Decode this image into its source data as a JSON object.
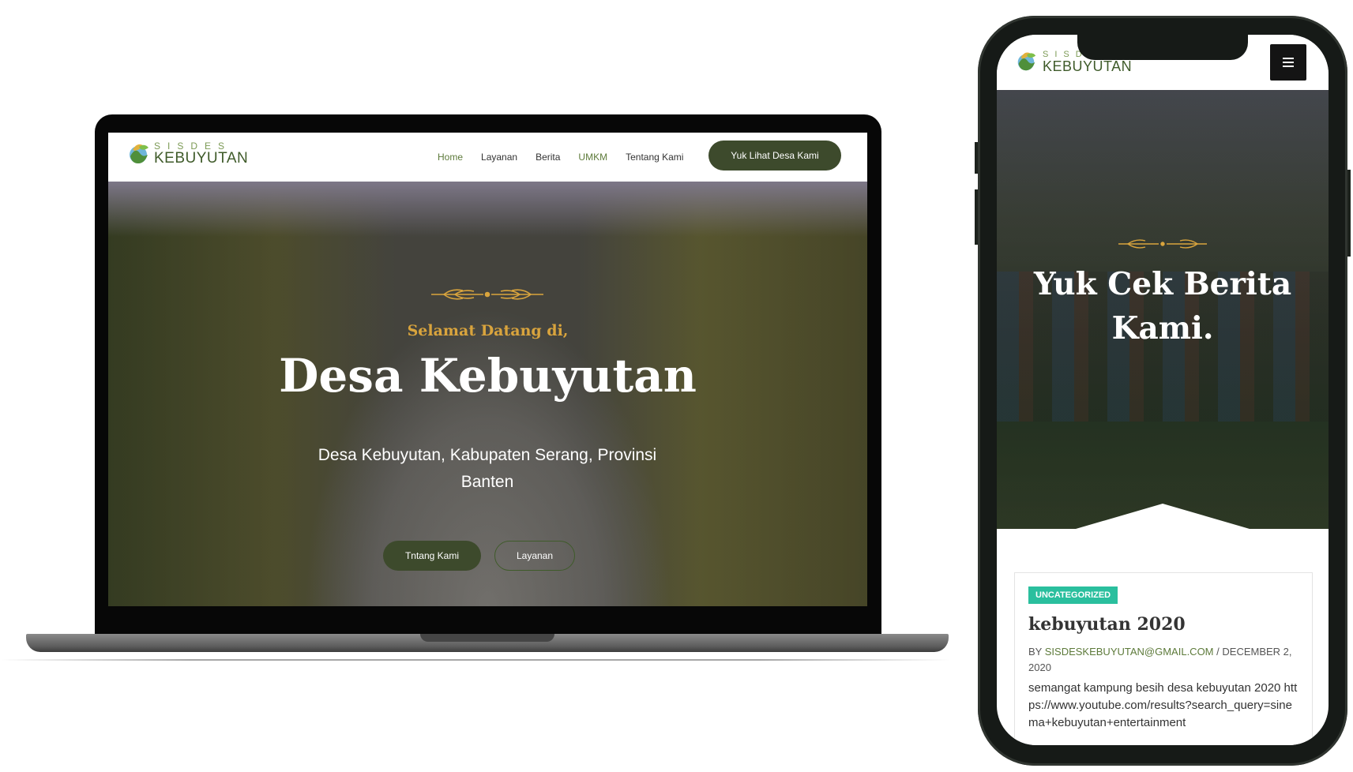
{
  "brand": {
    "logo_top": "SISDES",
    "logo_bottom": "KEBUYUTAN"
  },
  "laptop": {
    "nav": {
      "items": [
        {
          "label": "Home",
          "state": "active"
        },
        {
          "label": "Layanan",
          "state": ""
        },
        {
          "label": "Berita",
          "state": ""
        },
        {
          "label": "UMKM",
          "state": "highlight"
        },
        {
          "label": "Tentang Kami",
          "state": ""
        }
      ],
      "cta_label": "Yuk Lihat Desa Kami"
    },
    "hero": {
      "welcome": "Selamat Datang di,",
      "title": "Desa Kebuyutan",
      "subtitle": "Desa Kebuyutan, Kabupaten Serang, Provinsi Banten",
      "primary_button": "Tntang Kami",
      "secondary_button": "Layanan"
    }
  },
  "phone": {
    "hero_title": "Yuk Cek Berita Kami.",
    "post": {
      "category": "UNCATEGORIZED",
      "title": "kebuyutan 2020",
      "by_label": "BY",
      "author": "SISDESKEBUYUTAN@GMAIL.COM",
      "separator": "/",
      "date": "DECEMBER 2, 2020",
      "excerpt": "semangat kampung besih desa kebuyutan 2020 https://www.youtube.com/results?search_query=sinema+kebuyutan+entertainment"
    }
  },
  "colors": {
    "brand_dark_green": "#3d4a2c",
    "brand_green": "#5d7a3a",
    "gold": "#d9a43d",
    "badge_teal": "#2abf9e"
  },
  "icons": {
    "logo": "leaf-globe-logo-icon",
    "menu": "hamburger-menu-icon",
    "ornament": "wheat-ornament-icon"
  }
}
